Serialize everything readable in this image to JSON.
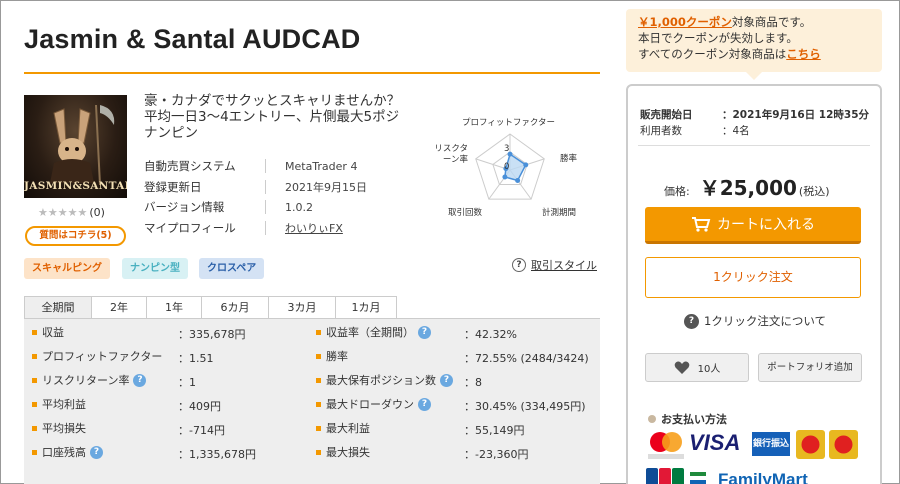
{
  "product": {
    "title": "Jasmin & Santal AUDCAD",
    "image_text": "JASMIN&SANTAL",
    "rating_stars": "★★★★★",
    "rating_count": "(0)",
    "qa_button": "質問はコチラ(5)",
    "description": "豪・カナダでサクッとスキャリませんか？平均一日3～4エントリー、片側最大5ポジナンピン",
    "meta": [
      {
        "label": "自動売買システム",
        "value": "MetaTrader 4"
      },
      {
        "label": "登録更新日",
        "value": "2021年9月15日"
      },
      {
        "label": "バージョン情報",
        "value": "1.0.2"
      },
      {
        "label": "マイプロフィール",
        "value": "わいりぃFX"
      }
    ],
    "tags": [
      "スキャルピング",
      "ナンピン型",
      "クロスペア"
    ],
    "trading_style_link": "取引スタイル"
  },
  "radar": {
    "axes": [
      "プロフィットファクター",
      "勝率",
      "計測期間",
      "取引回数",
      "リスクターン率"
    ],
    "scale_labels": [
      "3",
      "0"
    ],
    "values": [
      2.2,
      2.3,
      1.8,
      1.2,
      0.6
    ],
    "max": 5,
    "colors": {
      "fill": "#bcd8f2",
      "stroke": "#4a90d9",
      "grid": "#cccccc"
    }
  },
  "period_tabs": [
    "全期間",
    "2年",
    "1年",
    "6カ月",
    "3カ月",
    "1カ月"
  ],
  "active_tab": 0,
  "stats_left": [
    {
      "label": "収益",
      "value": "：335,678円",
      "help": false
    },
    {
      "label": "プロフィットファクター",
      "value": "：1.51",
      "help": false
    },
    {
      "label": "リスクリターン率",
      "value": "：1",
      "help": true
    },
    {
      "label": "平均利益",
      "value": "：409円",
      "help": false
    },
    {
      "label": "平均損失",
      "value": "：-714円",
      "help": false
    },
    {
      "label": "口座残高",
      "value": "：1,335,678円",
      "help": true
    }
  ],
  "stats_right": [
    {
      "label": "収益率（全期間）",
      "value": "：42.32%",
      "help": true
    },
    {
      "label": "勝率",
      "value": "：72.55% (2484/3424)",
      "help": false
    },
    {
      "label": "最大保有ポジション数",
      "value": "：8",
      "help": true
    },
    {
      "label": "最大ドローダウン",
      "value": "：30.45% (334,495円)",
      "help": true
    },
    {
      "label": "最大利益",
      "value": "：55,149円",
      "help": false
    },
    {
      "label": "最大損失",
      "value": "：-23,360円",
      "help": false
    }
  ],
  "sidebar": {
    "coupon_highlight": "￥1,000クーポン",
    "coupon_line1_rest": "対象商品です。",
    "coupon_line2": "本日でクーポンが失効します。",
    "coupon_line3": "すべてのクーポン対象商品は",
    "coupon_link": "こちら",
    "release_label": "販売開始日",
    "release_value": "：2021年9月16日 12時35分",
    "users_label": "利用者数",
    "users_value": "：4名",
    "price_label": "価格:",
    "price_value": "￥25,000",
    "price_tax": "(税込)",
    "cart_button": "カートに入れる",
    "oneclick_button": "1クリック注文",
    "oneclick_about": "1クリック注文について",
    "favorite_count": "10人",
    "portfolio_button": "ポートフォリオ追加",
    "payment_title": "お支払い方法",
    "pay_visa": "VISA",
    "pay_bank": "銀行振込",
    "pay_famima": "FamilyMart",
    "accent_color": "#f39800"
  }
}
